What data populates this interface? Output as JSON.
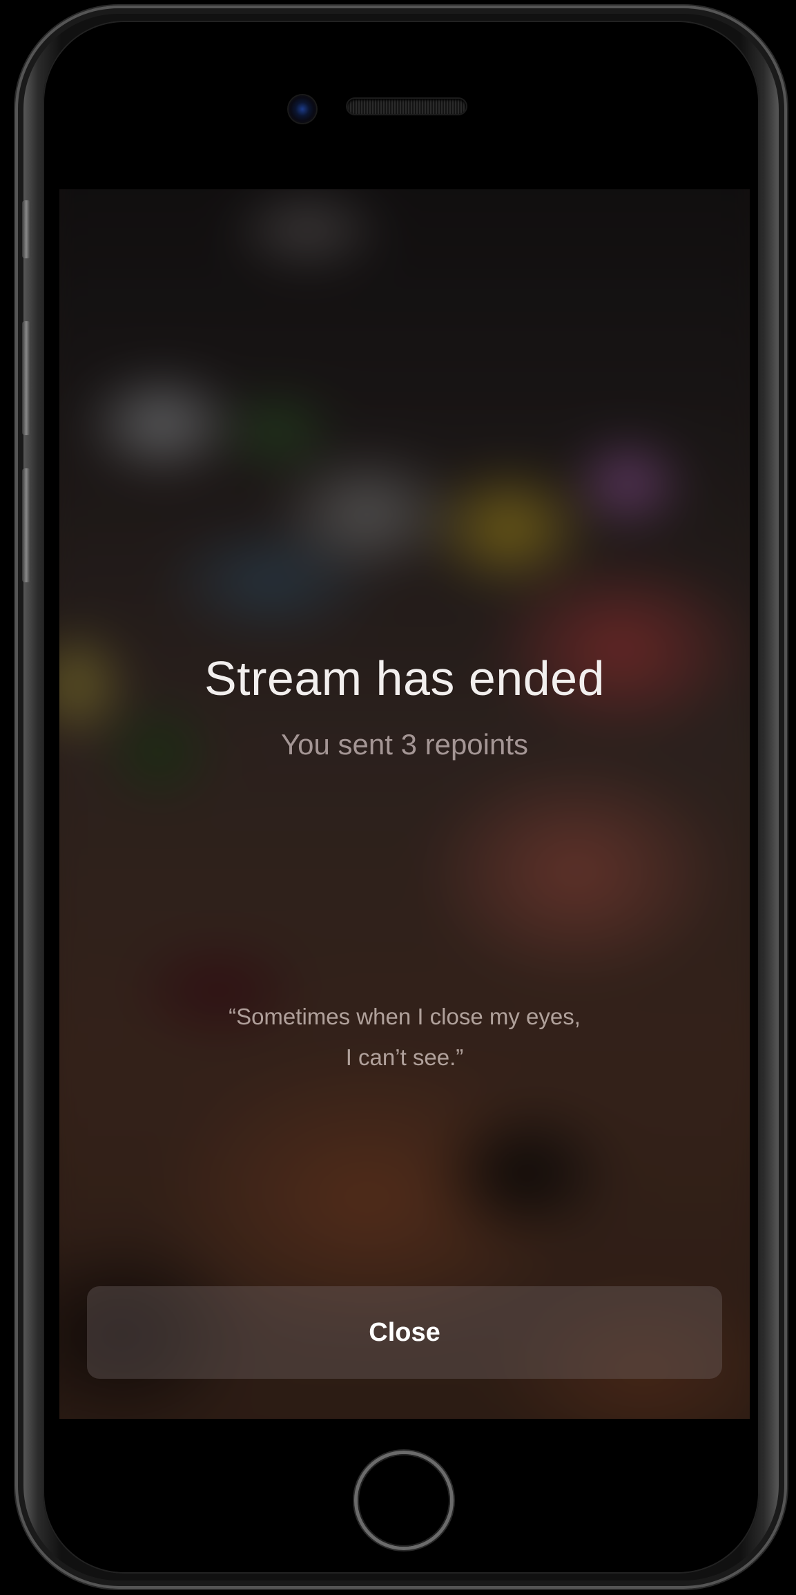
{
  "screen": {
    "title": "Stream has ended",
    "subtitle": "You sent 3 repoints",
    "quote_line1": "“Sometimes when I close my eyes,",
    "quote_line2": "I can’t see.”",
    "close_label": "Close"
  },
  "colors": {
    "title_text": "#f2efee",
    "button_text": "#ffffff",
    "device_frame": "#111111"
  },
  "icons": {
    "camera": "front-camera-icon",
    "speaker": "earpiece-speaker-icon",
    "home": "home-button-icon"
  }
}
